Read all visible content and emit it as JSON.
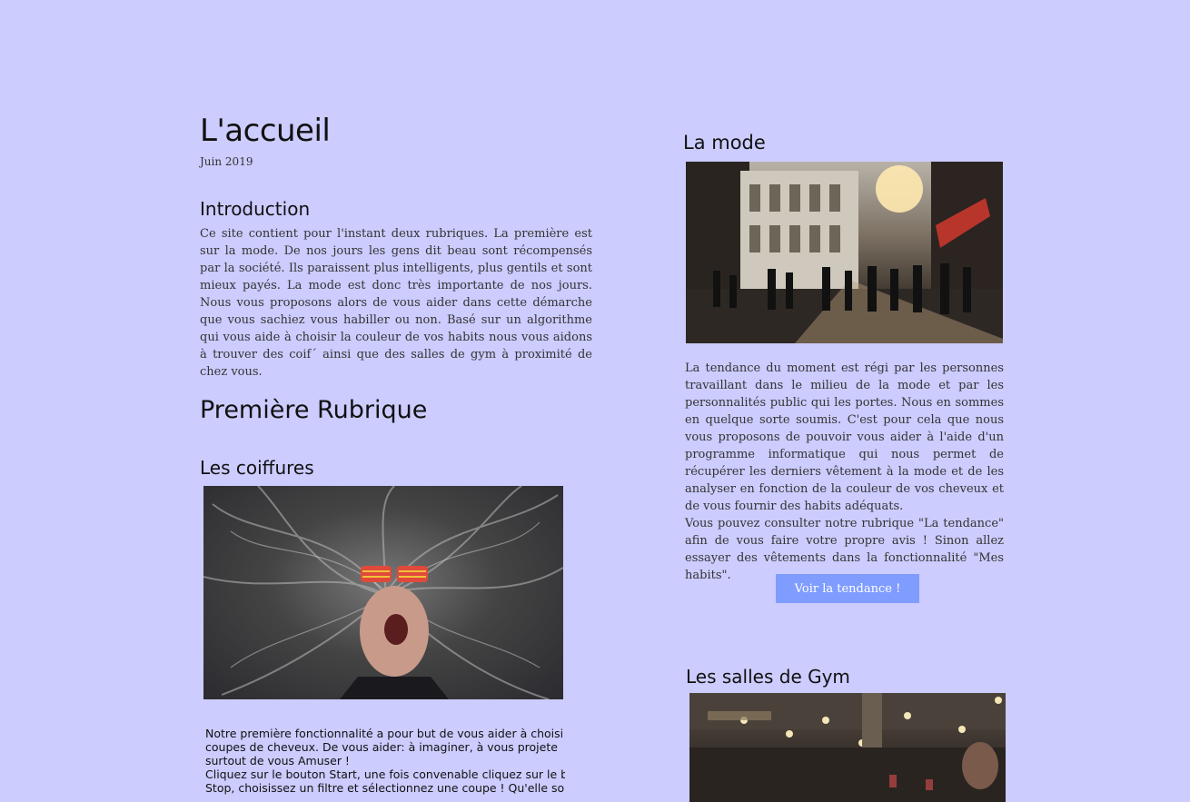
{
  "home": {
    "title": "L'accueil",
    "date": "Juin 2019",
    "intro_heading": "Introduction",
    "intro_text": "Ce site contient pour l'instant deux rubriques. La première est sur la mode. De nos jours les gens dit beau sont récompensés par la société. Ils paraissent plus intelligents, plus gentils et sont mieux payés. La mode est donc très importante de nos jours. Nous vous proposons alors de vous aider dans cette démarche que vous sachiez vous habiller ou non. Basé sur un algorithme qui vous aide à choisir la couleur de vos habits nous vous aidons à trouver des coif´ ainsi que des salles de gym à proximité de chez vous."
  },
  "rubrique": {
    "heading": "Première Rubrique",
    "coiffures_heading": "Les coiffures",
    "coiffures_text_lines": [
      "Notre première fonctionnalité a pour but de vous aider à choisi",
      "coupes de cheveux. De vous aider: à imaginer, à vous projete",
      "surtout de vous Amuser !",
      "Cliquez sur le bouton Start, une fois convenable cliquez sur le bo",
      "Stop, choisissez un filtre et sélectionnez une coupe ! Qu'elle soit c"
    ]
  },
  "mode": {
    "heading": "La mode",
    "text_1": "La tendance du moment est régi par les personnes travaillant dans le milieu de la mode et par les personnalités public qui les portes. Nous en sommes en quelque sorte soumis. C'est pour cela que nous vous proposons de pouvoir vous aider à l'aide d'un programme informatique qui nous permet de récupérer les derniers vêtement à la mode et de les analyser en fonction de la couleur de vos cheveux et de vous fournir des habits adéquats.",
    "text_2": "Vous pouvez consulter notre rubrique \"La tendance\" afin de vous faire votre propre avis ! Sinon allez essayer des vêtements dans la fonctionnalité \"Mes habits\".",
    "button_label": "Voir la tendance !"
  },
  "gym": {
    "heading": "Les salles de Gym"
  },
  "colors": {
    "background": "#ccccff",
    "button": "#7f9cff"
  }
}
